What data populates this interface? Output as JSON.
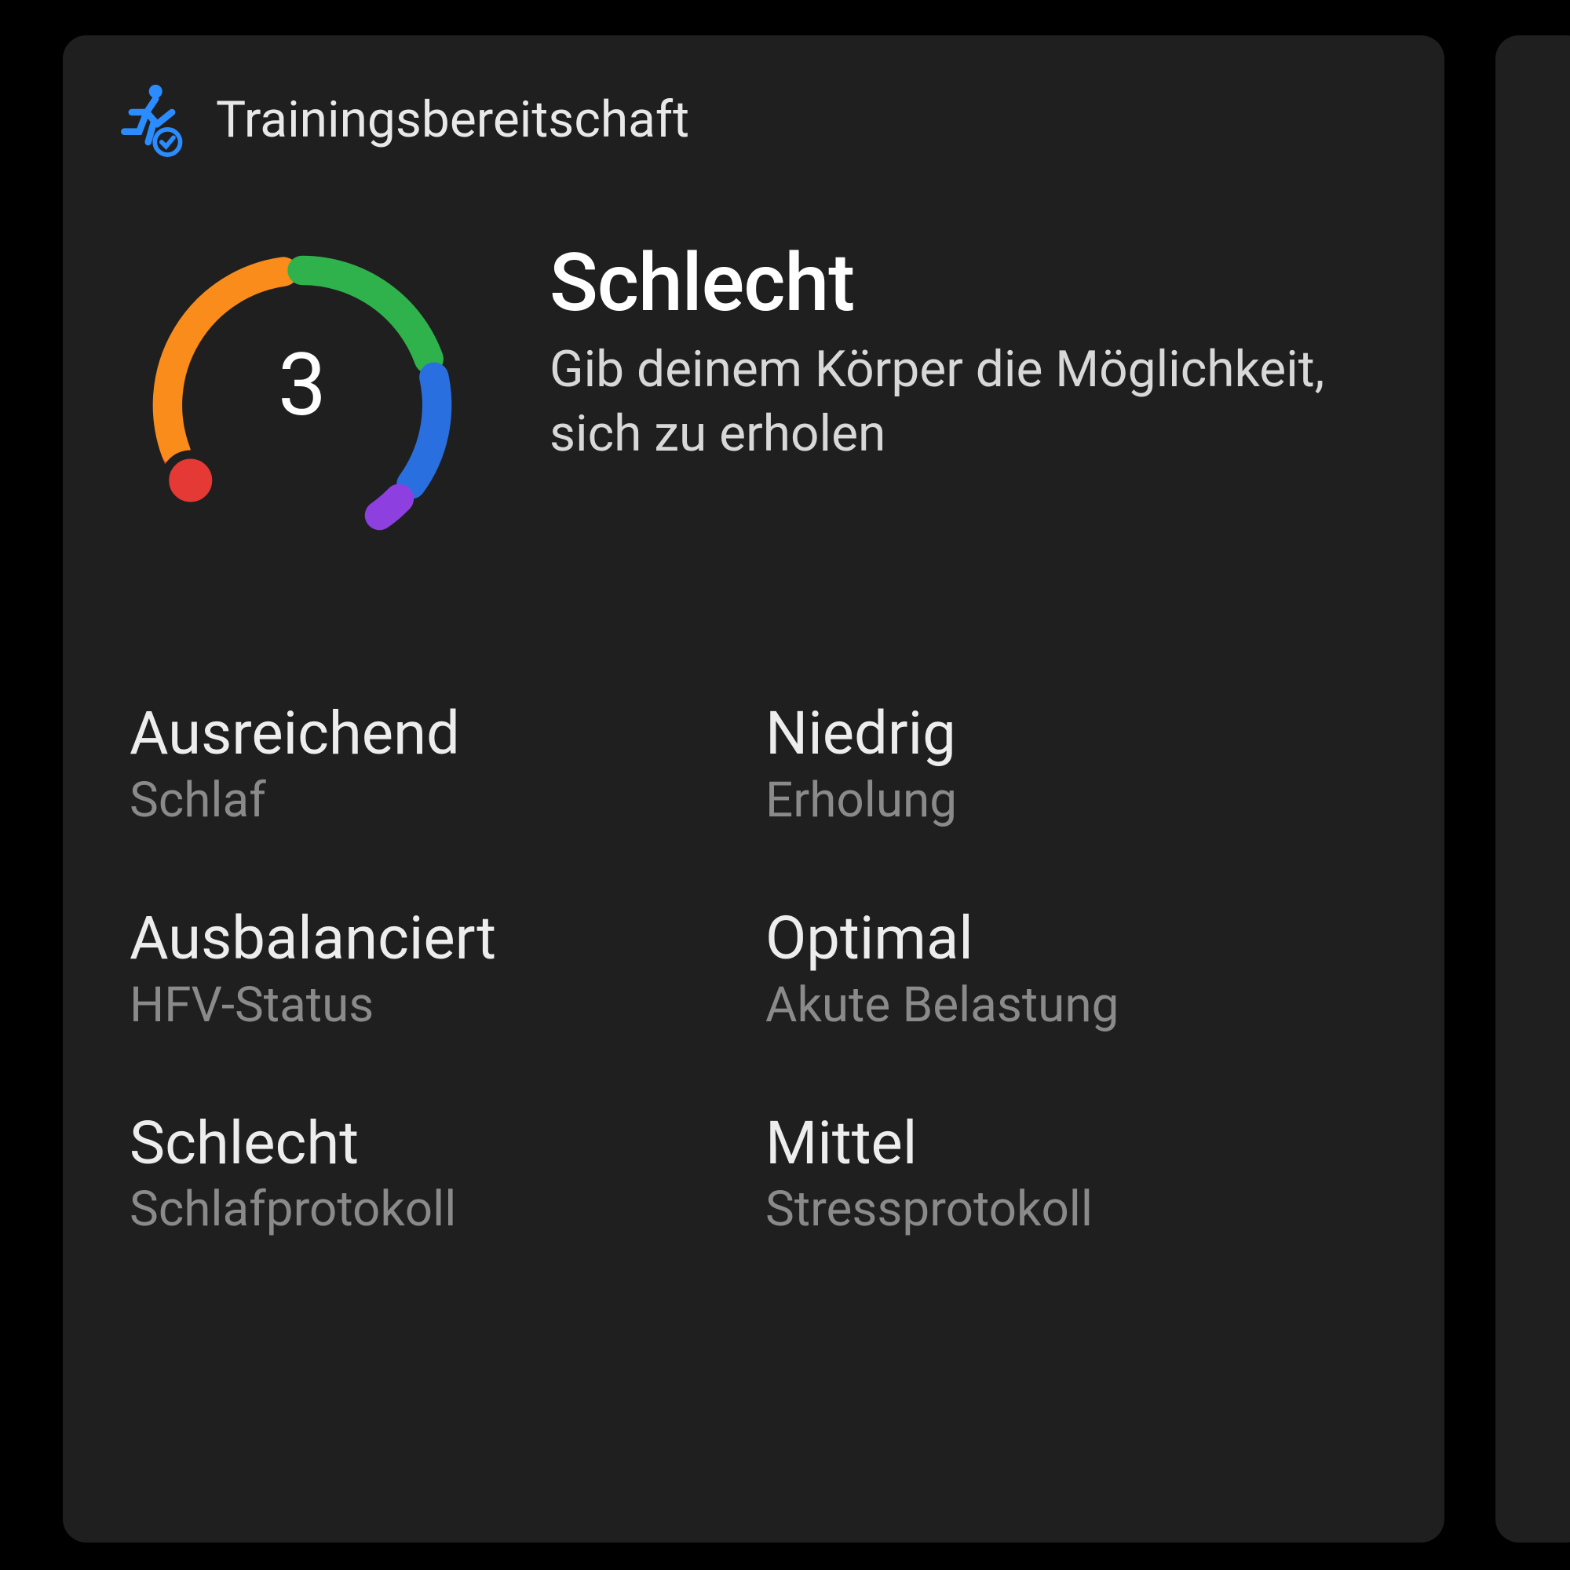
{
  "header": {
    "title": "Trainingsbereitschaft"
  },
  "gauge": {
    "score": "3",
    "segments": [
      {
        "color": "#e53935"
      },
      {
        "color": "#f98c1b"
      },
      {
        "color": "#2fb24c"
      },
      {
        "color": "#2a6fe0"
      },
      {
        "color": "#8e3fe0"
      }
    ],
    "indicator_color": "#e53935"
  },
  "status": {
    "title": "Schlecht",
    "subtitle": "Gib deinem Körper die Möglichkeit, sich zu erholen"
  },
  "metrics": [
    {
      "value": "Ausreichend",
      "label": "Schlaf"
    },
    {
      "value": "Niedrig",
      "label": "Erholung"
    },
    {
      "value": "Ausbalanciert",
      "label": "HFV-Status"
    },
    {
      "value": "Optimal",
      "label": "Akute Belastung"
    },
    {
      "value": "Schlecht",
      "label": "Schlafprotokoll"
    },
    {
      "value": "Mittel",
      "label": "Stressprotokoll"
    }
  ]
}
